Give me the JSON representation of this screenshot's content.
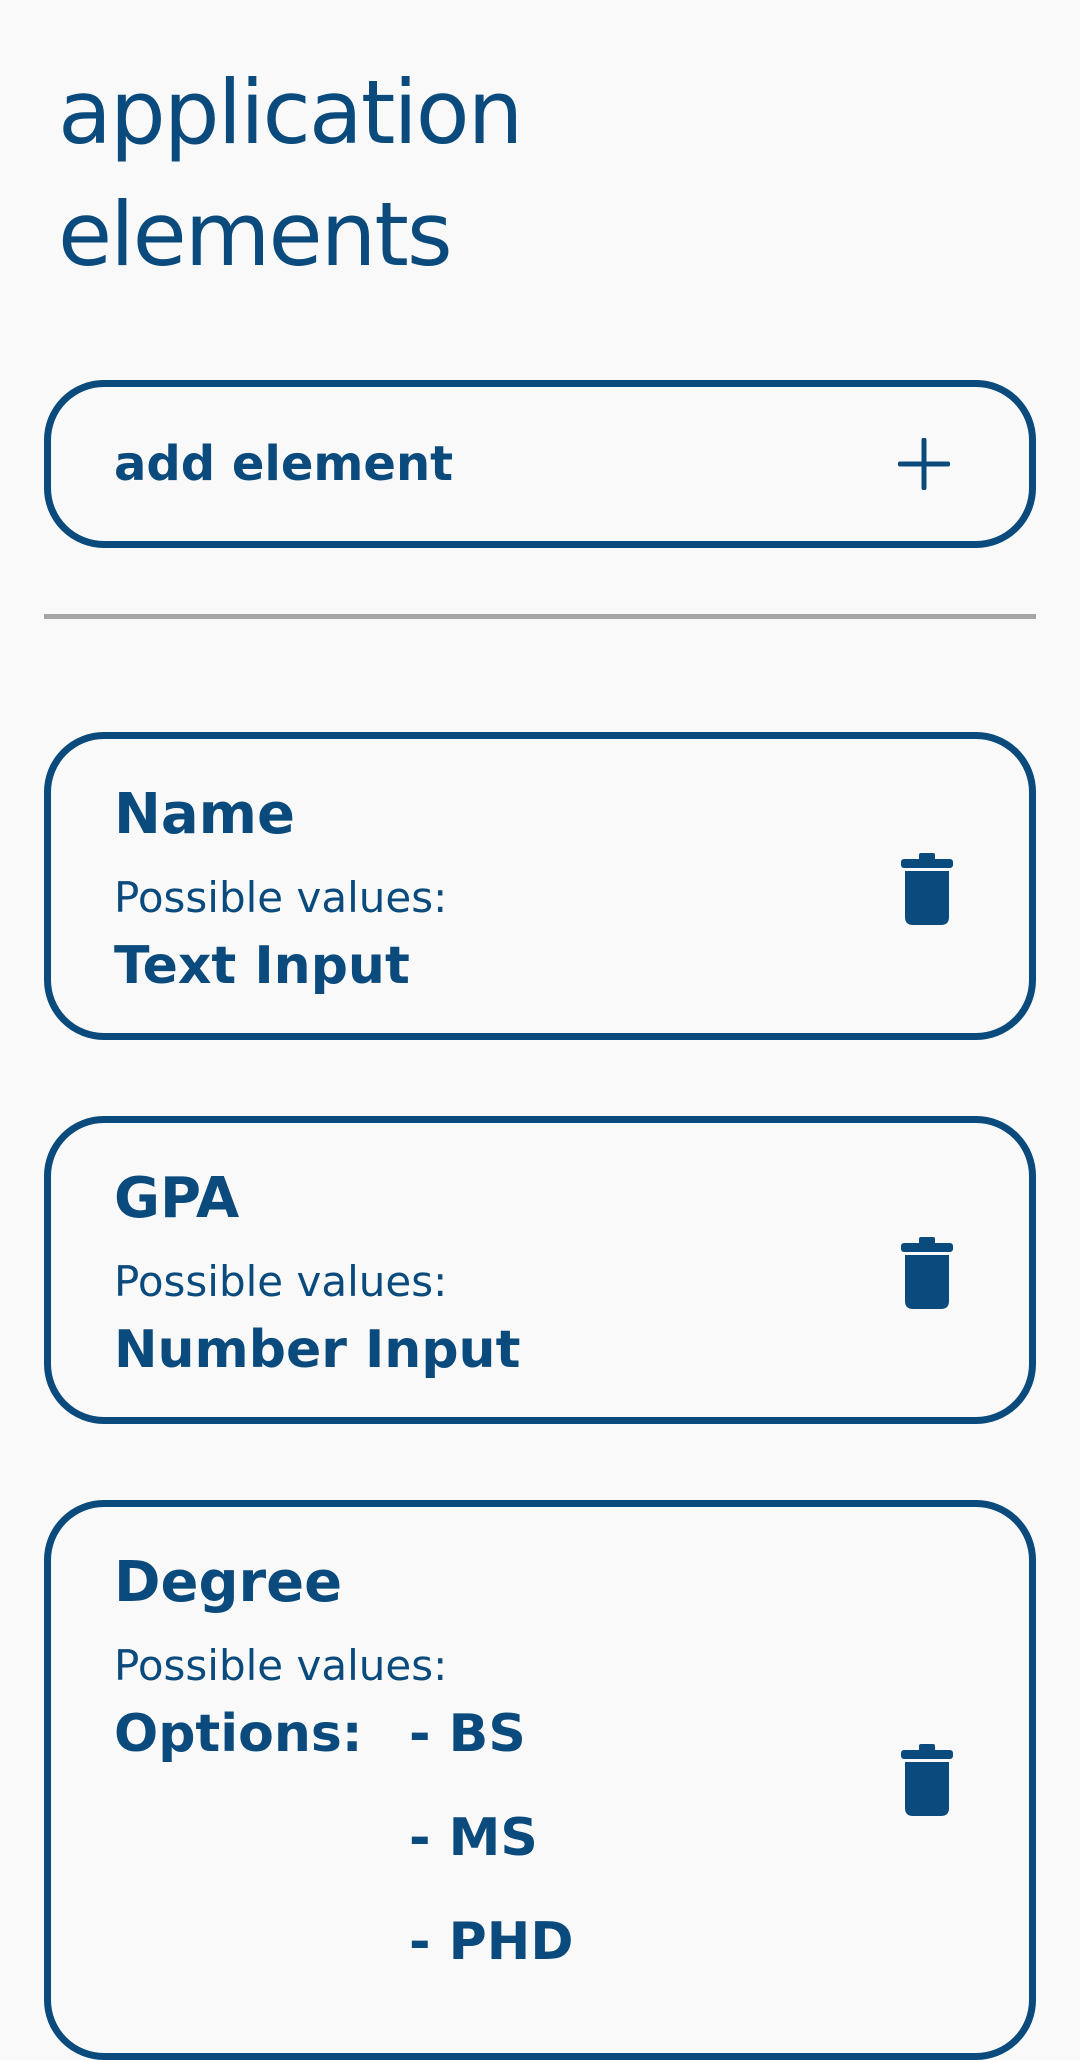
{
  "header": {
    "title_line1": "application",
    "title_line2": "elements"
  },
  "add_button": {
    "label": "add element",
    "icon": "plus-icon"
  },
  "elements": [
    {
      "name": "Name",
      "possible_values_label": "Possible values:",
      "type": "Text Input",
      "delete_icon": "trash-icon"
    },
    {
      "name": "GPA",
      "possible_values_label": "Possible values:",
      "type": "Number Input",
      "delete_icon": "trash-icon"
    },
    {
      "name": "Degree",
      "possible_values_label": "Possible values:",
      "type": "Options:",
      "options": [
        "- BS",
        "- MS",
        "- PHD"
      ],
      "delete_icon": "trash-icon"
    }
  ],
  "colors": {
    "accent": "#0a4a7c",
    "divider": "#a6a6a6",
    "background": "#f9f9f9"
  }
}
